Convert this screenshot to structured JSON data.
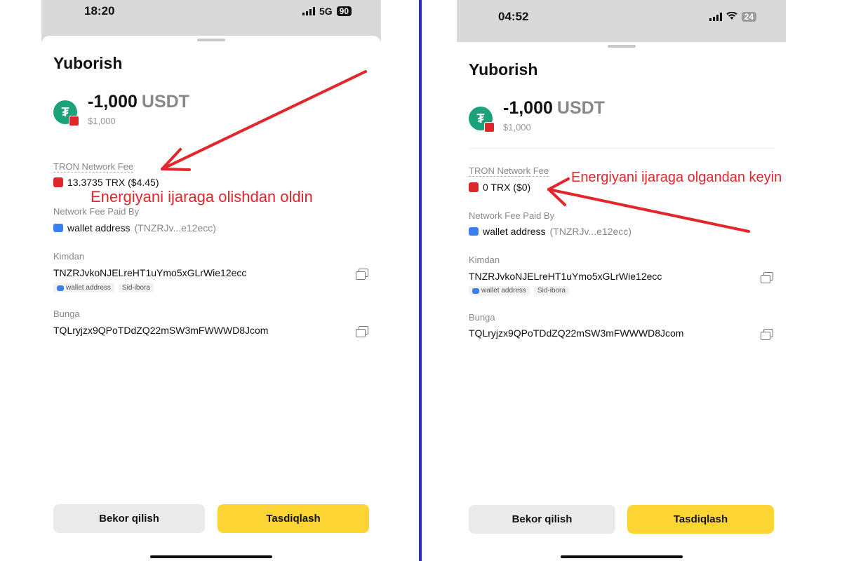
{
  "left": {
    "status": {
      "time": "18:20",
      "network": "5G",
      "battery": "90"
    },
    "title": "Yuborish",
    "amount": "-1,000",
    "unit": "USDT",
    "fiat": "$1,000",
    "fee_label": "TRON Network Fee",
    "fee_value": "13.3735 TRX ($4.45)",
    "paid_by_label": "Network Fee Paid By",
    "paid_by_name": "wallet address",
    "paid_by_addr": "(TNZRJv...e12ecc)",
    "from_label": "Kimdan",
    "from_addr": "TNZRJvkoNJELreHT1uYmo5xGLrWie12ecc",
    "tag_wallet": "wallet address",
    "tag_seed": "Sid-ibora",
    "to_label": "Bunga",
    "to_addr": "TQLryjzx9QPoTDdZQ22mSW3mFWWWD8Jcom",
    "cancel": "Bekor qilish",
    "confirm": "Tasdiqlash"
  },
  "right": {
    "status": {
      "time": "04:52",
      "battery": "24"
    },
    "title": "Yuborish",
    "amount": "-1,000",
    "unit": "USDT",
    "fiat": "$1,000",
    "fee_label": "TRON Network Fee",
    "fee_value": "0 TRX ($0)",
    "paid_by_label": "Network Fee Paid By",
    "paid_by_name": "wallet address",
    "paid_by_addr": "(TNZRJv...e12ecc)",
    "from_label": "Kimdan",
    "from_addr": "TNZRJvkoNJELreHT1uYmo5xGLrWie12ecc",
    "tag_wallet": "wallet address",
    "tag_seed": "Sid-ibora",
    "to_label": "Bunga",
    "to_addr": "TQLryjzx9QPoTDdZQ22mSW3mFWWWD8Jcom",
    "cancel": "Bekor qilish",
    "confirm": "Tasdiqlash"
  },
  "annotations": {
    "before": "Energiyani ijaraga olishdan oldin",
    "after": "Energiyani ijaraga olgandan keyin"
  },
  "colors": {
    "accent": "#fcd535",
    "annotation": "#e3262b",
    "divider": "#2c2ad0",
    "usdt": "#1ba27a",
    "tron": "#e0262b"
  },
  "icons": [
    "signal-icon",
    "wifi-icon",
    "battery-icon",
    "usdt-coin-icon",
    "tron-icon",
    "wallet-icon",
    "copy-icon"
  ]
}
